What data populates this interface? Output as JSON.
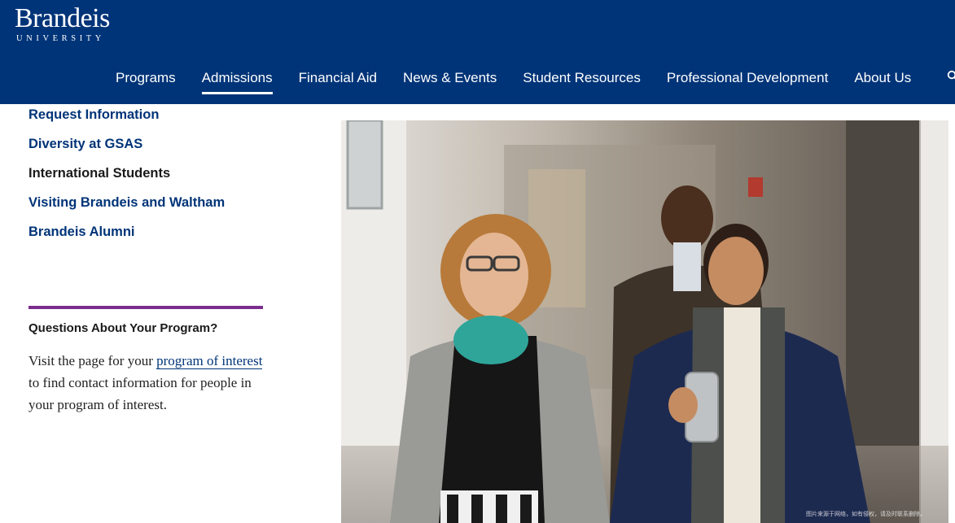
{
  "header": {
    "logo_word": "Brandeis",
    "logo_sub": "UNIVERSITY",
    "nav": [
      {
        "label": "Programs",
        "active": false
      },
      {
        "label": "Admissions",
        "active": true
      },
      {
        "label": "Financial Aid",
        "active": false
      },
      {
        "label": "News & Events",
        "active": false
      },
      {
        "label": "Student Resources",
        "active": false
      },
      {
        "label": "Professional Development",
        "active": false
      },
      {
        "label": "About Us",
        "active": false
      }
    ],
    "search_icon": "search-icon",
    "colors": {
      "background": "#003478",
      "text": "#ffffff"
    }
  },
  "sidebar": {
    "links": [
      {
        "label": "Request Information",
        "current": false
      },
      {
        "label": "Diversity at GSAS",
        "current": false
      },
      {
        "label": "International Students",
        "current": true
      },
      {
        "label": "Visiting Brandeis and Waltham",
        "current": false
      },
      {
        "label": "Brandeis Alumni",
        "current": false
      }
    ],
    "link_color": "#003478"
  },
  "callout": {
    "title": "Questions About Your Program?",
    "body_before": "Visit the page for your ",
    "link_text": "program of interest",
    "body_after": " to find contact information for people in your program of interest.",
    "rule_color": "#7b2d8e"
  },
  "photo": {
    "credit": "图片来源于网络，如有侵权，请及时联系删除。"
  }
}
